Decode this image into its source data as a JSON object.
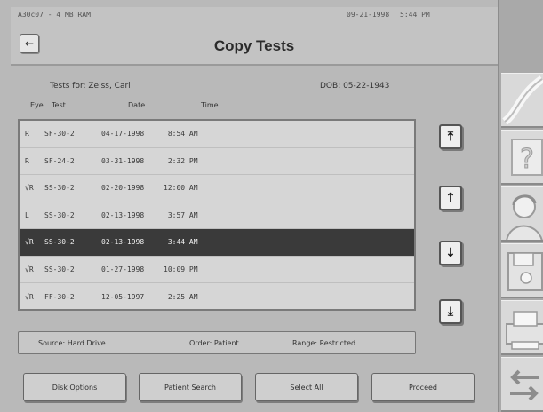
{
  "header": {
    "sys_left": "A30c07 - 4 MB RAM",
    "sys_date": "09-21-1998",
    "sys_time": "5:44 PM",
    "back_label": "←",
    "title": "Copy Tests"
  },
  "patient": {
    "tests_for": "Tests for: Zeiss, Carl",
    "dob": "DOB: 05-22-1943"
  },
  "columns": {
    "eye": "Eye",
    "test": "Test",
    "date": "Date",
    "time": "Time"
  },
  "tests": [
    {
      "eye": "R",
      "test": "SF-30-2",
      "date": "04-17-1998",
      "time": " 8:54 AM"
    },
    {
      "eye": "R",
      "test": "SF-24-2",
      "date": "03-31-1998",
      "time": " 2:32 PM"
    },
    {
      "eye": "√R",
      "test": "SS-30-2",
      "date": "02-20-1998",
      "time": "12:00 AM"
    },
    {
      "eye": "L",
      "test": "SS-30-2",
      "date": "02-13-1998",
      "time": " 3:57 AM"
    },
    {
      "eye": "√R",
      "test": "SS-30-2",
      "date": "02-13-1998",
      "time": " 3:44 AM",
      "selected": true
    },
    {
      "eye": "√R",
      "test": "SS-30-2",
      "date": "01-27-1998",
      "time": "10:09 PM"
    },
    {
      "eye": "√R",
      "test": "FF-30-2",
      "date": "12-05-1997",
      "time": " 2:25 AM"
    }
  ],
  "nav": {
    "top_icon": "arrow-to-top-icon",
    "up_icon": "arrow-up-icon",
    "down_icon": "arrow-down-icon",
    "bottom_icon": "arrow-to-bottom-icon",
    "top_glyph": "⤒",
    "up_glyph": "↑",
    "down_glyph": "↓",
    "bottom_glyph": "⤓"
  },
  "status": {
    "source": "Source: Hard Drive",
    "order": "Order: Patient",
    "range": "Range: Restricted"
  },
  "buttons": {
    "disk_options": "Disk Options",
    "patient_search": "Patient Search",
    "select_all": "Select All",
    "proceed": "Proceed"
  },
  "sidebar": [
    {
      "icon": "swoosh-icon"
    },
    {
      "icon": "help-question-icon"
    },
    {
      "icon": "patient-profile-icon"
    },
    {
      "icon": "floppy-disk-icon"
    },
    {
      "icon": "printer-icon"
    },
    {
      "icon": "swap-arrows-icon"
    }
  ]
}
